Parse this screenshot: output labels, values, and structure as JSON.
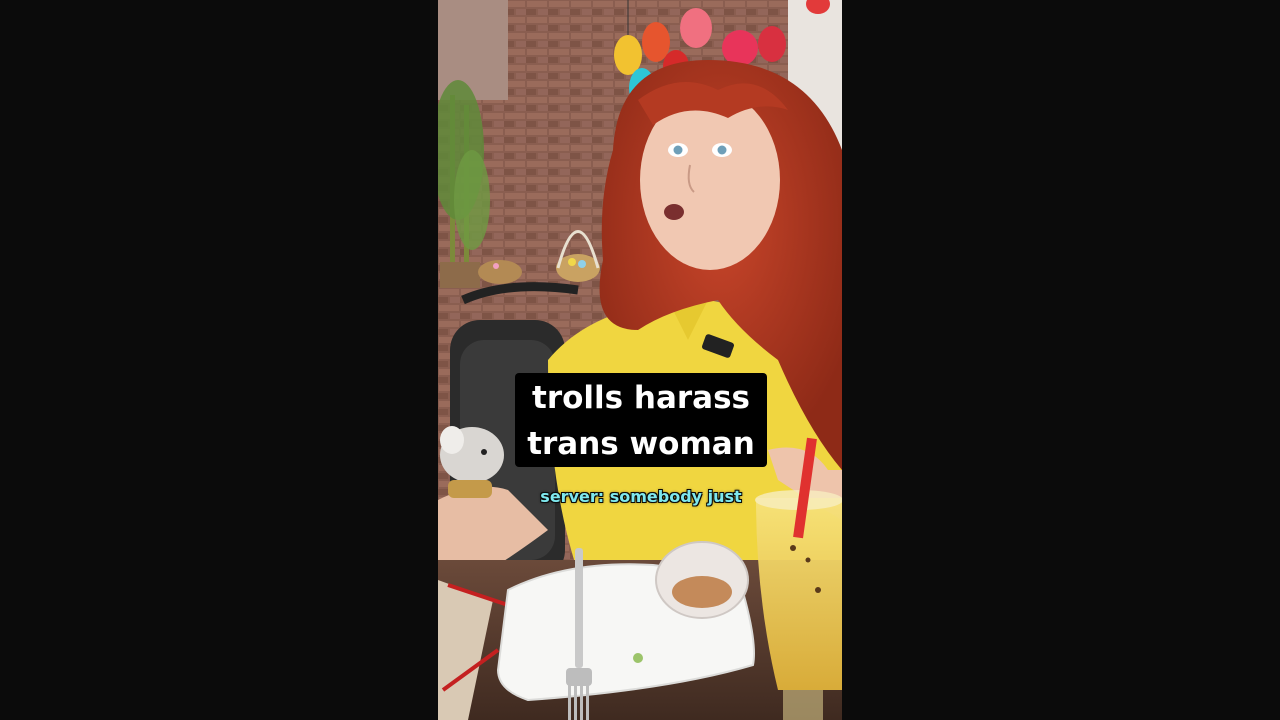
{
  "video": {
    "caption_lines": [
      "trolls harass",
      "trans woman"
    ],
    "subtitle": "server: somebody just"
  },
  "colors": {
    "letterbox": "#0b0b0b",
    "caption_background": "#000000",
    "caption_text": "#ffffff",
    "subtitle_text": "#7fe8ee"
  }
}
